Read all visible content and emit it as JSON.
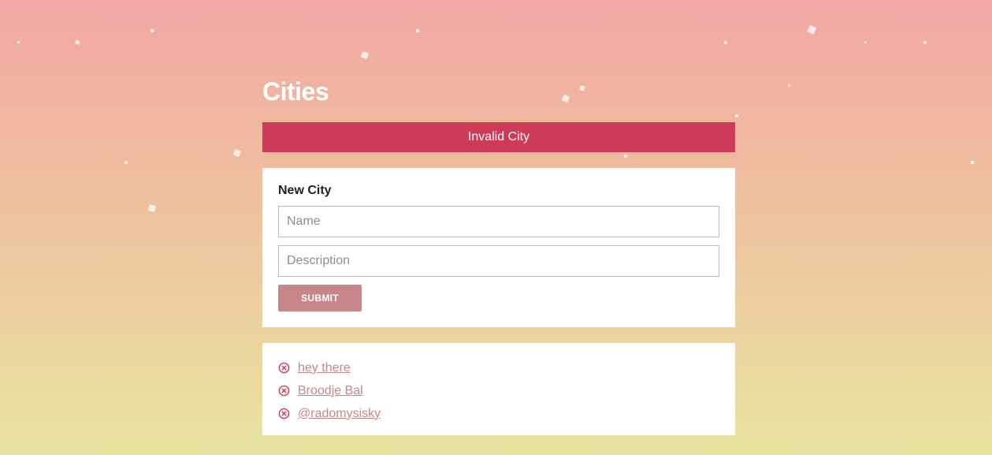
{
  "page": {
    "title": "Cities"
  },
  "error_banner": {
    "message": "Invalid City"
  },
  "form": {
    "heading": "New City",
    "name_placeholder": "Name",
    "name_value": "",
    "description_placeholder": "Description",
    "description_value": "",
    "submit_label": "SUBMIT"
  },
  "cities": [
    {
      "label": "hey there",
      "remove_icon": "close-circle-icon"
    },
    {
      "label": "Broodje Bal",
      "remove_icon": "close-circle-icon"
    },
    {
      "label": "@radomysisky",
      "remove_icon": "close-circle-icon"
    }
  ],
  "colors": {
    "error": "#cf3a59",
    "accent": "#c78688",
    "background_top": "#f3a8a4",
    "background_bottom": "#e8e4a0"
  }
}
